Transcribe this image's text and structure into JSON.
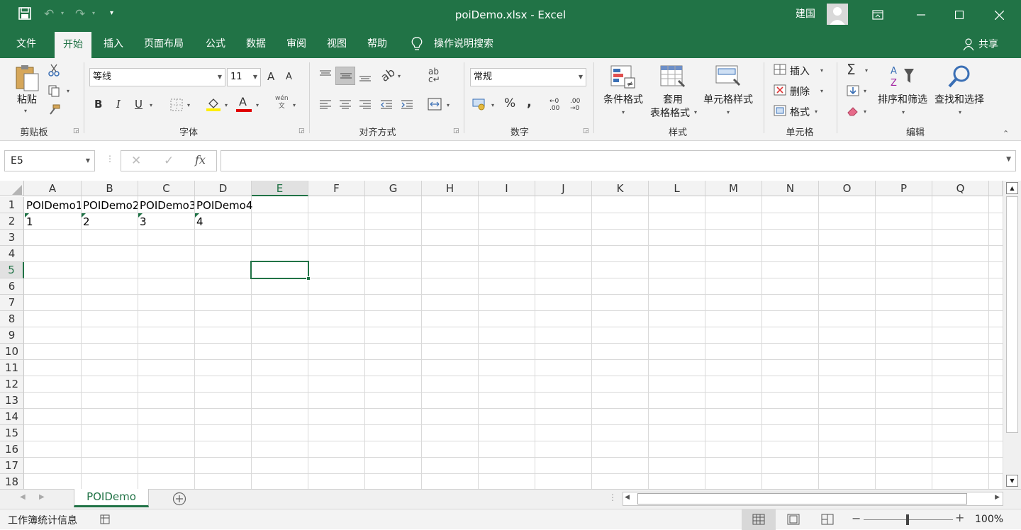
{
  "window": {
    "title": "poiDemo.xlsx  -  Excel",
    "user": "建国"
  },
  "menu": [
    "文件",
    "开始",
    "插入",
    "页面布局",
    "公式",
    "数据",
    "审阅",
    "视图",
    "帮助"
  ],
  "tellme": "操作说明搜索",
  "share": "共享",
  "ribbon": {
    "paste": "粘贴",
    "clipboard": "剪贴板",
    "font_name": "等线",
    "font_size": "11",
    "font_group": "字体",
    "bold": "B",
    "italic": "I",
    "underline": "U",
    "grow": "A",
    "shrink": "A",
    "font_color_letter": "A",
    "wen": "wén\n文",
    "align_group": "对齐方式",
    "number_format": "常规",
    "number_group": "数字",
    "cond_format": "条件格式",
    "table_format_1": "套用",
    "table_format_2": "表格格式",
    "cell_styles": "单元格样式",
    "styles_group": "样式",
    "insert": "插入",
    "delete": "删除",
    "format": "格式",
    "cells_group": "单元格",
    "sort_filter": "排序和筛选",
    "find_select": "查找和选择",
    "edit_group": "编辑",
    "sigma": "Σ",
    "percent": "%",
    "comma": ","
  },
  "formula": {
    "name_box": "E5",
    "fx": "fx",
    "value": ""
  },
  "columns": [
    "A",
    "B",
    "C",
    "D",
    "E",
    "F",
    "G",
    "H",
    "I",
    "J",
    "K",
    "L",
    "M",
    "N",
    "O",
    "P",
    "Q"
  ],
  "rows": [
    "1",
    "2",
    "3",
    "4",
    "5",
    "6",
    "7",
    "8",
    "9",
    "10",
    "11",
    "12",
    "13",
    "14",
    "15",
    "16",
    "17",
    "18"
  ],
  "cells": {
    "A1": "POIDemo1",
    "B1": "POIDemo2",
    "C1": "POIDemo3",
    "D1": "POIDemo4",
    "A2": "1",
    "B2": "2",
    "C2": "3",
    "D2": "4"
  },
  "sheet_tab": "POIDemo",
  "status": {
    "text": "工作簿统计信息",
    "zoom": "100%",
    "minus": "−",
    "plus": "+"
  }
}
